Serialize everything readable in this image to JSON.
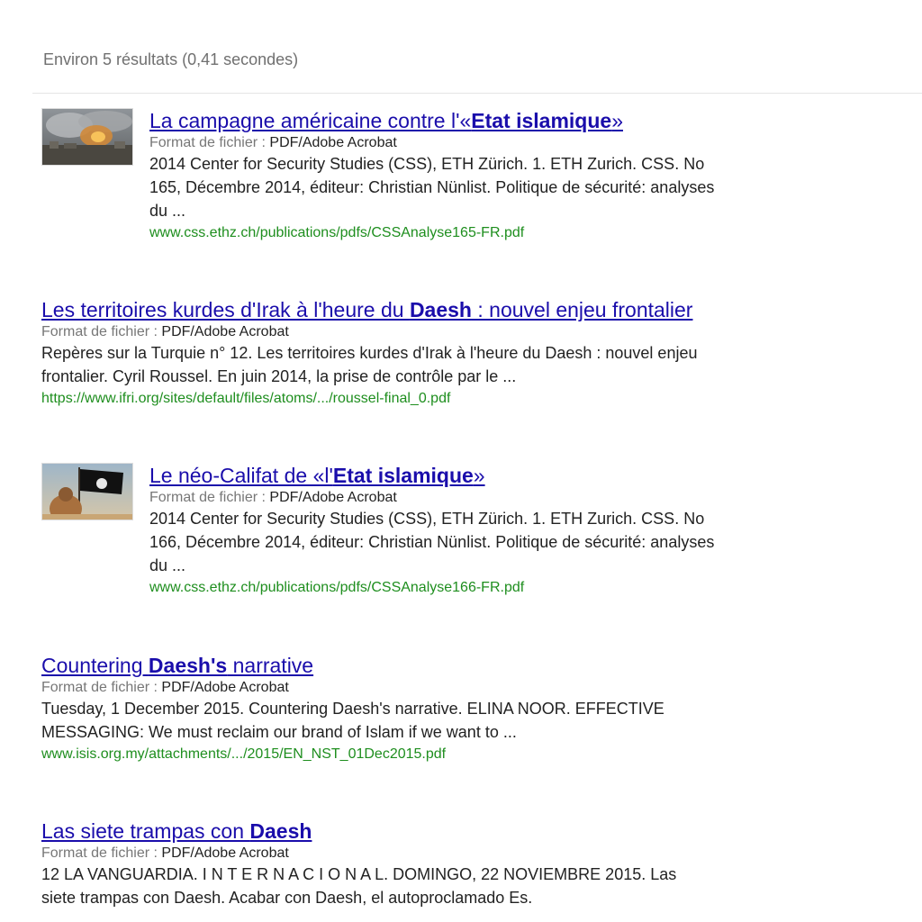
{
  "stats": "Environ 5 résultats (0,41 secondes)",
  "format_label": "Format de fichier :",
  "results": [
    {
      "title_pre": "La campagne américaine contre l'«",
      "title_bold": "Etat islamique",
      "title_post": "»",
      "format_value": "PDF/Adobe Acrobat",
      "snippet_lines": [
        "2014 Center for Security Studies (CSS), ETH Zürich. 1. ETH Zurich. CSS. No",
        "165, Décembre 2014, éditeur: Christian Nünlist. Politique de sécurité: analyses",
        "du ..."
      ],
      "url": "www.css.ethz.ch/publications/pdfs/CSSAnalyse165-FR.pdf",
      "thumbnail": "smoke-explosion-photo"
    },
    {
      "title_pre": "Les territoires kurdes d'Irak à l'heure du ",
      "title_bold": "Daesh",
      "title_post": " : nouvel enjeu frontalier",
      "format_value": "PDF/Adobe Acrobat",
      "snippet_lines": [
        "Repères sur la Turquie n° 12. Les territoires kurdes d'Irak à l'heure du Daesh : nouvel enjeu",
        "frontalier. Cyril Roussel. En juin 2014, la prise de contrôle par le ..."
      ],
      "url": "https://www.ifri.org/sites/default/files/atoms/.../roussel-final_0.pdf"
    },
    {
      "title_pre": "Le néo-Califat de «l'",
      "title_bold": "Etat islamique",
      "title_post": "»",
      "format_value": "PDF/Adobe Acrobat",
      "snippet_lines": [
        "2014 Center for Security Studies (CSS), ETH Zürich. 1. ETH Zurich. CSS. No",
        "166, Décembre 2014, éditeur: Christian Nünlist. Politique de sécurité: analyses",
        "du ..."
      ],
      "url": "www.css.ethz.ch/publications/pdfs/CSSAnalyse166-FR.pdf",
      "thumbnail": "black-flag-photo"
    },
    {
      "title_pre": "Countering ",
      "title_bold": "Daesh's",
      "title_post": " narrative",
      "format_value": "PDF/Adobe Acrobat",
      "snippet_lines": [
        "Tuesday, 1 December 2015. Countering Daesh's narrative. ELINA NOOR. EFFECTIVE",
        "MESSAGING: We must reclaim our brand of Islam if we want to ..."
      ],
      "url": "www.isis.org.my/attachments/.../2015/EN_NST_01Dec2015.pdf"
    },
    {
      "title_pre": "Las siete trampas con ",
      "title_bold": "Daesh",
      "title_post": "",
      "format_value": "PDF/Adobe Acrobat",
      "snippet_lines": [
        "12 LA VANGUARDIA. I N T E R N A C I O N A L. DOMINGO, 22 NOVIEMBRE 2015. Las",
        "siete trampas con Daesh. Acabar con Daesh, el autoproclamado Es."
      ]
    }
  ]
}
